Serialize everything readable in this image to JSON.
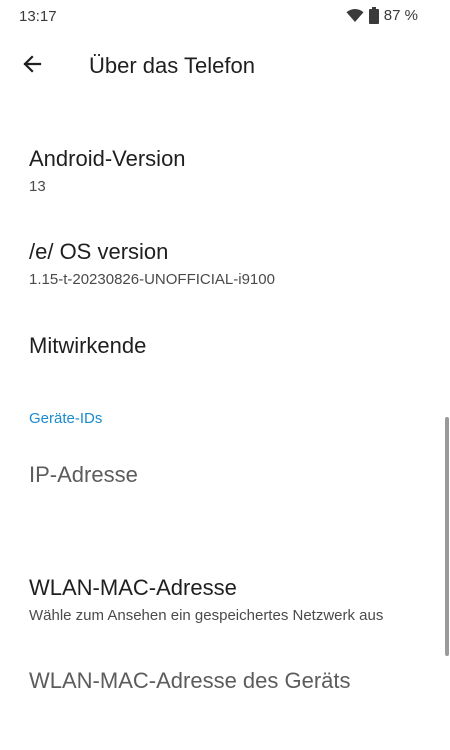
{
  "status_bar": {
    "time": "13:17",
    "battery": "87 %",
    "icons": [
      "wifi-icon",
      "battery-icon"
    ]
  },
  "header": {
    "title": "Über das Telefon",
    "back_icon": "back-arrow-icon"
  },
  "items": [
    {
      "title": "Android-Version",
      "summary": "13"
    },
    {
      "title": "/e/ OS version",
      "summary": "1.15-t-20230826-UNOFFICIAL-i9100"
    },
    {
      "title": "Mitwirkende"
    }
  ],
  "section": {
    "header": "Geräte-IDs",
    "items": [
      {
        "title": "IP-Adresse"
      },
      {
        "title": "WLAN-MAC-Adresse",
        "summary": "Wähle zum Ansehen ein gespeichertes Netzwerk aus"
      },
      {
        "title": "WLAN-MAC-Adresse des Geräts"
      }
    ]
  },
  "colors": {
    "accent": "#1a8acf",
    "text_primary": "#1f1f1f",
    "text_secondary": "#4a4a4a"
  }
}
